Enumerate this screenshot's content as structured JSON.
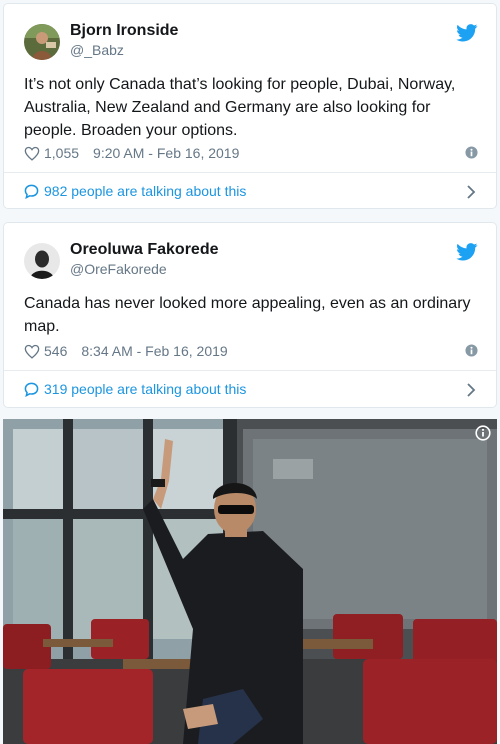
{
  "tweets": [
    {
      "name": "Bjorn Ironside",
      "handle": "@_Babz",
      "text": "It’s not only Canada that’s looking for people, Dubai, Norway, Australia, New Zealand  and Germany are also looking for people. Broaden your options.",
      "likes": "1,055",
      "timestamp": "9:20 AM - Feb 16, 2019",
      "talking": "982 people are talking about this"
    },
    {
      "name": "Oreoluwa Fakorede",
      "handle": "@OreFakorede",
      "text": "Canada has never looked more appealing, even as an ordinary map.",
      "likes": "546",
      "timestamp": "8:34 AM - Feb 16, 2019",
      "talking": "319 people are talking about this"
    }
  ],
  "icons": {
    "brand": "twitter-bird-icon",
    "like": "heart-icon",
    "info": "info-icon",
    "talk": "speech-bubble-icon",
    "more": "chevron-right-icon"
  },
  "colors": {
    "accent": "#1da1f2",
    "link": "#1b95e0",
    "muted": "#657786",
    "text": "#14171a",
    "border": "#e1e8ed"
  }
}
